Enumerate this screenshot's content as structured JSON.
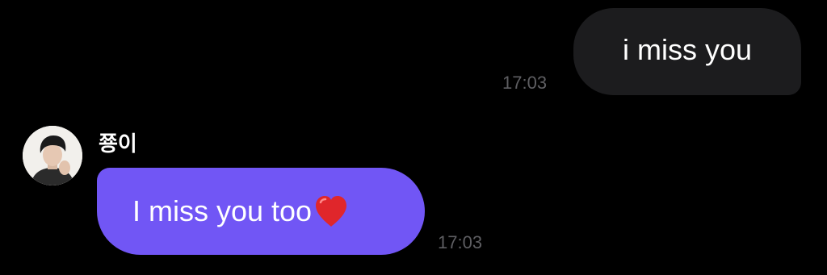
{
  "chat": {
    "messages": [
      {
        "direction": "outgoing",
        "text": "i miss you",
        "time": "17:03"
      },
      {
        "direction": "incoming",
        "sender": "쭁이",
        "text": "I miss you too",
        "emoji": "heart-icon",
        "time": "17:03"
      }
    ]
  },
  "colors": {
    "background": "#000000",
    "outgoing_bubble": "#1c1c1e",
    "incoming_bubble": "#7156f5",
    "timestamp": "#5e5e62",
    "text": "#ffffff",
    "heart": "#e0262b"
  }
}
